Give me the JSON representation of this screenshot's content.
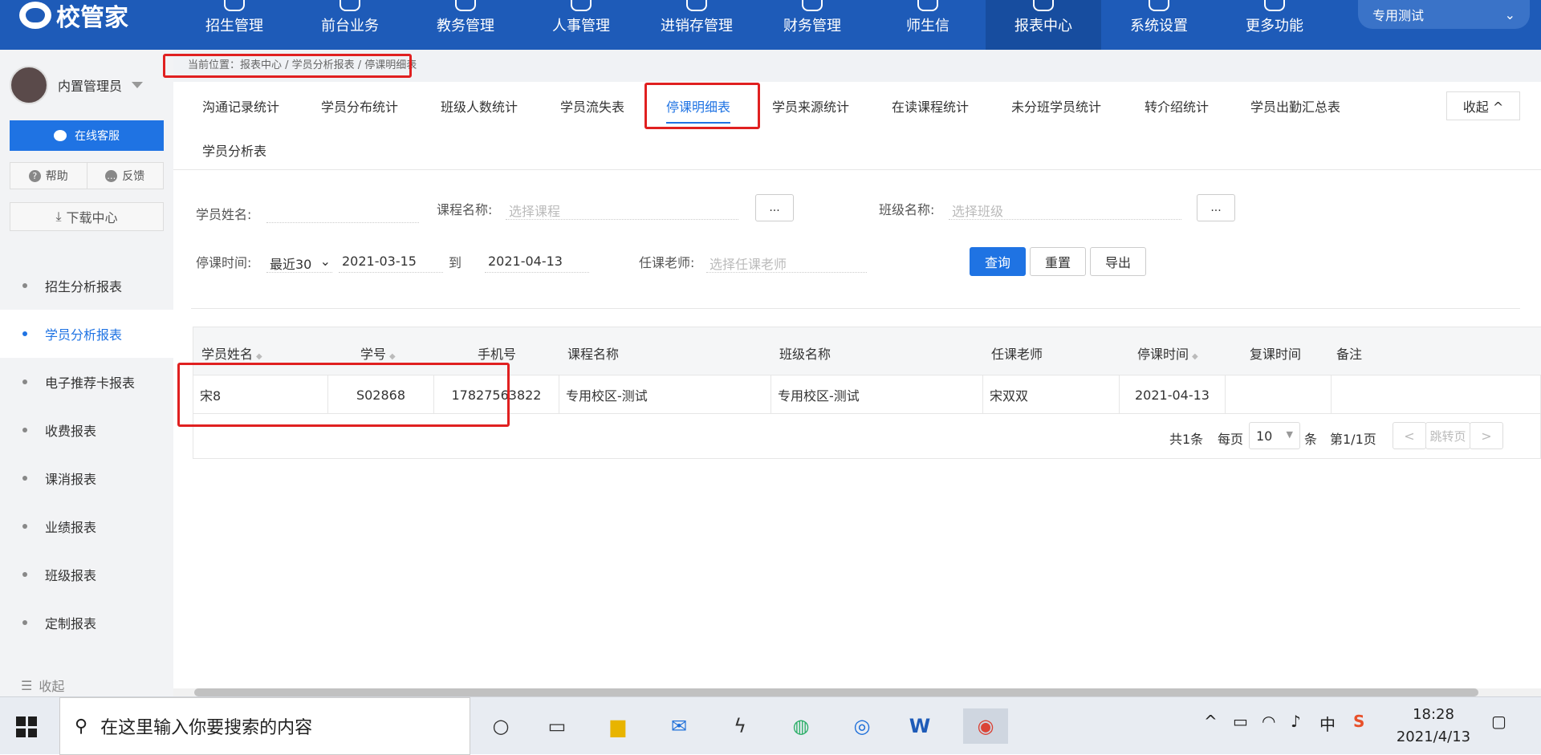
{
  "header": {
    "logo_text": "校管家",
    "nav": [
      "招生管理",
      "前台业务",
      "教务管理",
      "人事管理",
      "进销存管理",
      "财务管理",
      "师生信",
      "报表中心",
      "系统设置",
      "更多功能"
    ],
    "active_nav": "报表中心",
    "campus": "专用测试"
  },
  "sidebar": {
    "user": "内置管理员",
    "service": "在线客服",
    "help": "帮助",
    "feedback": "反馈",
    "download": "下载中心",
    "items": [
      "招生分析报表",
      "学员分析报表",
      "电子推荐卡报表",
      "收费报表",
      "课消报表",
      "业绩报表",
      "班级报表",
      "定制报表"
    ],
    "active": "学员分析报表",
    "collapse": "收起"
  },
  "breadcrumb": "当前位置：报表中心 / 学员分析报表 / 停课明细表",
  "tabs": [
    "沟通记录统计",
    "学员分布统计",
    "班级人数统计",
    "学员流失表",
    "停课明细表",
    "学员来源统计",
    "在读课程统计",
    "未分班学员统计",
    "转介绍统计",
    "学员出勤汇总表",
    "学员分析表"
  ],
  "collapse_btn": "收起 ^",
  "filters": {
    "student_name_label": "学员姓名:",
    "course_label": "课程名称:",
    "course_placeholder": "选择课程",
    "class_label": "班级名称:",
    "class_placeholder": "选择班级",
    "ellipsis": "...",
    "stop_time_label": "停课时间:",
    "range_select": "最近30",
    "date_from": "2021-03-15",
    "to": "到",
    "date_to": "2021-04-13",
    "teacher_label": "任课老师:",
    "teacher_placeholder": "选择任课老师",
    "query": "查询",
    "reset": "重置",
    "export": "导出"
  },
  "table": {
    "headers": [
      "学员姓名",
      "学号",
      "手机号",
      "课程名称",
      "班级名称",
      "任课老师",
      "停课时间",
      "复课时间",
      "备注"
    ],
    "rows": [
      [
        "宋8",
        "S02868",
        "17827563822",
        "专用校区-测试",
        "专用校区-测试",
        "宋双双",
        "2021-04-13",
        "",
        ""
      ]
    ]
  },
  "pager": {
    "total": "共1条",
    "per_page": "每页",
    "size": "10",
    "unit": "条",
    "page": "第1/1页",
    "prev": "<",
    "jump": "跳转页",
    "next": ">"
  },
  "taskbar": {
    "search": "在这里输入你要搜索的内容",
    "ime": "中",
    "time": "18:28",
    "date": "2021/4/13"
  }
}
